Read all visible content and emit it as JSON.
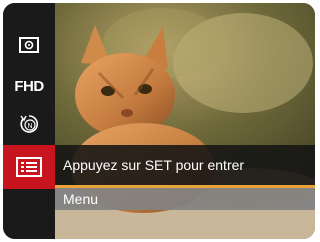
{
  "sidebar": {
    "items": [
      {
        "icon": "exposure-metering-icon"
      },
      {
        "label": "FHD"
      },
      {
        "icon": "rotation-mode-icon"
      },
      {
        "icon": "menu-list-icon"
      }
    ]
  },
  "hint": {
    "text": "Appuyez sur SET pour entrer"
  },
  "menu": {
    "label": "Menu"
  },
  "colors": {
    "accent": "#e8a33a",
    "active": "#c8141e"
  }
}
